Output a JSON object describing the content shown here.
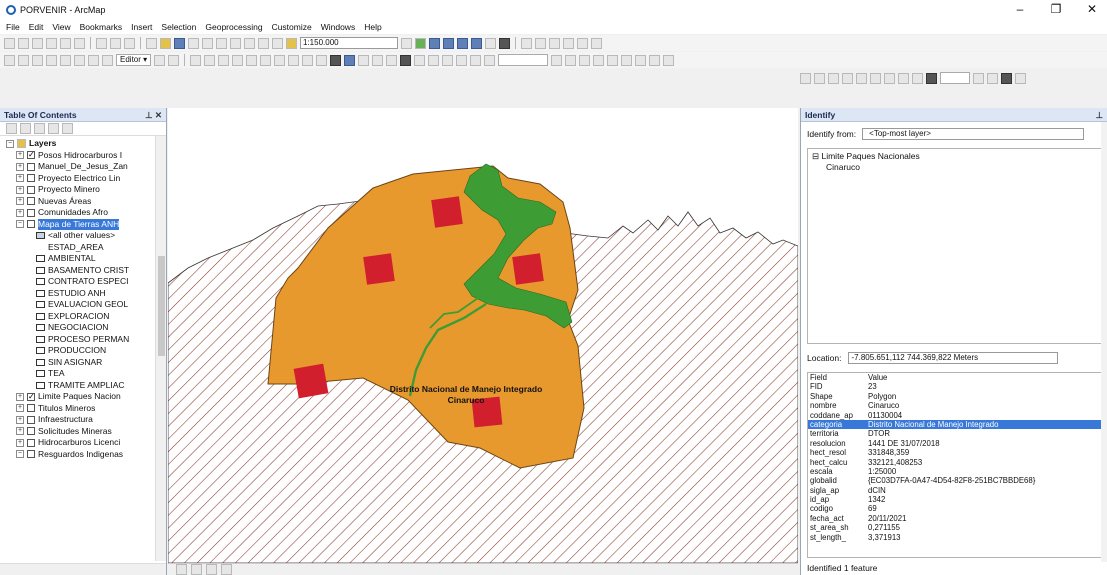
{
  "window": {
    "title": "PORVENIR - ArcMap",
    "controls": [
      "–",
      "❐",
      "✕"
    ]
  },
  "menu": [
    "File",
    "Edit",
    "View",
    "Bookmarks",
    "Insert",
    "Selection",
    "Geoprocessing",
    "Customize",
    "Windows",
    "Help"
  ],
  "toolbar": {
    "scale": "1:150.000",
    "editor_label": "Editor ▾"
  },
  "toc": {
    "title": "Table Of Contents",
    "root": "Layers",
    "items": [
      {
        "label": "Posos Hidrocarburos I",
        "checked": true,
        "level": 1,
        "expand": "+"
      },
      {
        "label": "Manuel_De_Jesus_Zan",
        "checked": false,
        "level": 1,
        "expand": "+"
      },
      {
        "label": "Proyecto Electrico Lin",
        "checked": false,
        "level": 1,
        "expand": "+"
      },
      {
        "label": "Proyecto Minero",
        "checked": false,
        "level": 1,
        "expand": "+"
      },
      {
        "label": "Nuevas Áreas",
        "checked": false,
        "level": 1,
        "expand": "+"
      },
      {
        "label": "Comunidades Afro",
        "checked": false,
        "level": 1,
        "expand": "+"
      },
      {
        "label": "Mapa de Tierras ANH",
        "checked": false,
        "level": 1,
        "expand": "−",
        "selected": true
      }
    ],
    "legend_all_other": "<all other values>",
    "legend_field": "ESTAD_AREA",
    "legend_values": [
      "AMBIENTAL",
      "BASAMENTO CRIST",
      "CONTRATO ESPECI",
      "ESTUDIO ANH",
      "EVALUACION GEOL",
      "EXPLORACION",
      "NEGOCIACION",
      "PROCESO PERMAN",
      "PRODUCCION",
      "SIN ASIGNAR",
      "TEA",
      "TRAMITE AMPLIAC"
    ],
    "more_items": [
      {
        "label": "Limite Paques Nacion",
        "checked": true
      },
      {
        "label": "Titulos Mineros",
        "checked": false
      },
      {
        "label": "Infraestructura",
        "checked": false
      },
      {
        "label": "Solicitudes Mineras",
        "checked": false
      },
      {
        "label": "Hidrocarburos Licenci",
        "checked": false
      },
      {
        "label": "Resguardos Indigenas",
        "checked": false
      }
    ]
  },
  "map": {
    "label_line1": "Distrito Nacional de Manejo Integrado",
    "label_line2": "Cinaruco",
    "colors": {
      "polygon": "#e8992e",
      "outline": "#7a4e18",
      "squares": "#d21f2e",
      "river": "#3e9c35",
      "hatch": "#8a3c2c"
    }
  },
  "identify": {
    "title": "Identify",
    "from_label": "Identify from:",
    "from_value": "<Top-most layer>",
    "tree_layer": "Limite Paques Nacionales",
    "tree_feature": "Cinaruco",
    "location_label": "Location:",
    "location_value": "-7.805.651,112  744.369,822 Meters",
    "attr_header": {
      "field": "Field",
      "value": "Value"
    },
    "attrs": [
      {
        "field": "FID",
        "value": "23"
      },
      {
        "field": "Shape",
        "value": "Polygon"
      },
      {
        "field": "nombre",
        "value": "Cinaruco"
      },
      {
        "field": "coddane_ap",
        "value": "01130004"
      },
      {
        "field": "categoria",
        "value": "Distrito Nacional de Manejo Integrado",
        "highlight": true
      },
      {
        "field": "territoria",
        "value": "DTOR"
      },
      {
        "field": "resolucion",
        "value": "1441 DE 31/07/2018"
      },
      {
        "field": "hect_resol",
        "value": "331848,359"
      },
      {
        "field": "hect_calcu",
        "value": "332121,408253"
      },
      {
        "field": "escala",
        "value": "1:25000"
      },
      {
        "field": "globalid",
        "value": "{EC03D7FA-0A47-4D54-82F8-251BC7BBDE68}"
      },
      {
        "field": "sigla_ap",
        "value": "dCIN"
      },
      {
        "field": "id_ap",
        "value": "1342"
      },
      {
        "field": "codigo",
        "value": "69"
      },
      {
        "field": "fecha_act",
        "value": "20/11/2021"
      },
      {
        "field": "st_area_sh",
        "value": "0,271155"
      },
      {
        "field": "st_length_",
        "value": "3,371913"
      }
    ],
    "status": "Identified 1 feature"
  }
}
